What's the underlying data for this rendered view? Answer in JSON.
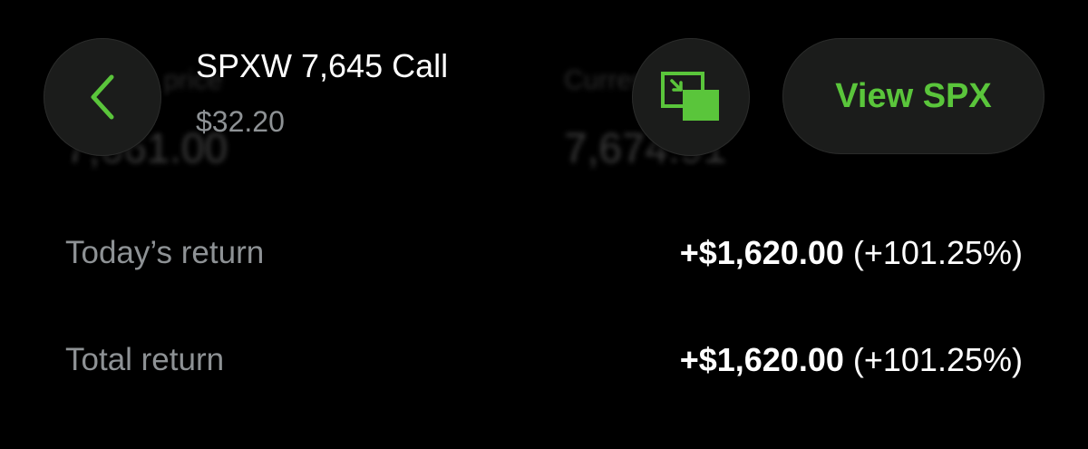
{
  "background": {
    "left_label": "Current price",
    "left_value": "7,661.00",
    "right_label": "Current SPX",
    "right_value": "7,674.91"
  },
  "header": {
    "back_icon": "chevron-left-icon",
    "title": "SPXW 7,645 Call",
    "price": "$32.20",
    "pip_icon": "picture-in-picture-icon",
    "view_button_label": "View SPX"
  },
  "returns": {
    "today": {
      "label": "Today’s return",
      "amount": "+$1,620.00",
      "percent": "(+101.25%)"
    },
    "total": {
      "label": "Total return",
      "amount": "+$1,620.00",
      "percent": "(+101.25%)"
    }
  },
  "colors": {
    "accent": "#5ac53b",
    "background": "#000000",
    "button_bg": "#1b1c1b",
    "muted_text": "#8e9295"
  }
}
